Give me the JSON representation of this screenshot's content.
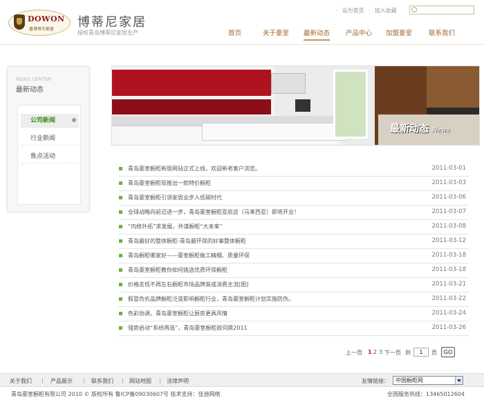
{
  "logo": {
    "brand": "DOWON",
    "sub": "香港帝王家居"
  },
  "site": {
    "title": "博蒂尼家居",
    "subtitle": "授权青岛博蒂尼家居生产"
  },
  "toplinks": {
    "home": "设为首页",
    "favorite": "加入收藏"
  },
  "search": {
    "placeholder": ""
  },
  "nav": [
    "首页",
    "关于豪室",
    "最新动态",
    "产品中心",
    "加盟豪室",
    "联系我们"
  ],
  "nav_active": "最新动态",
  "sidebar": {
    "title_en": "NEWS CENTER",
    "title_cn": "最新动态",
    "items": [
      "公司新闻",
      "行业新闻",
      "焦点活动"
    ],
    "active": "公司新闻"
  },
  "banner": {
    "caption": "最新动态",
    "caption_en": "News"
  },
  "news": [
    {
      "title": "青岛豪室橱柜新版网站正式上线，欢迎新老客户浏览。",
      "date": "2011-03-01"
    },
    {
      "title": "青岛豪室橱柜现推出一款特价橱柜",
      "date": "2011-03-03"
    },
    {
      "title": "青岛豪室橱柜引领家居业步入低碳时代",
      "date": "2011-03-06"
    },
    {
      "title": "全球战略向前迈进一步，青岛豪室橱柜亚庇店（马来西亚）即将开业！",
      "date": "2011-03-07"
    },
    {
      "title": "“内修外拓”求发展，共谋橱柜“大未来”",
      "date": "2011-03-08"
    },
    {
      "title": "青岛最好的整体橱柜-青岛最环保的好事整体橱柜",
      "date": "2011-03-12"
    },
    {
      "title": "青岛橱柜哪家好——豪室橱柜做工精细、质量环保",
      "date": "2011-03-18"
    },
    {
      "title": "青岛豪室橱柜教你如何挑选优质环保橱柜",
      "date": "2011-03-18"
    },
    {
      "title": "价格走低不再左右橱柜市场品牌渐成消费主流[图]",
      "date": "2011-03-21"
    },
    {
      "title": "假冒伪劣品牌橱柜泛滥影响橱柜行业，青岛豪室橱柜计划实施防伪。",
      "date": "2011-03-22"
    },
    {
      "title": "色彩协调，青岛豪室橱柜让厨房更具风情",
      "date": "2011-03-24"
    },
    {
      "title": "强势启动“系统再造”，青岛豪室橱柜欲问鼎2011",
      "date": "2011-03-26"
    }
  ],
  "pager": {
    "prev": "上一页",
    "current": "1",
    "page2": "2",
    "page3": "3",
    "next": "下一页",
    "goto": "到",
    "input": "1",
    "unit": "页",
    "go": "GO"
  },
  "footer": {
    "links": [
      "关于我们",
      "产品展示",
      "联系我们",
      "网站地图",
      "法律声明"
    ],
    "friend_label": "友情链接：",
    "friend_selected": "中国橱柜网"
  },
  "copyright": "青岛豪室橱柜有限公司 2010 © 版权所有 鲁ICP备09030607号 技术支持：佳迪网络",
  "hotline": "全国服务热线：13465012604"
}
